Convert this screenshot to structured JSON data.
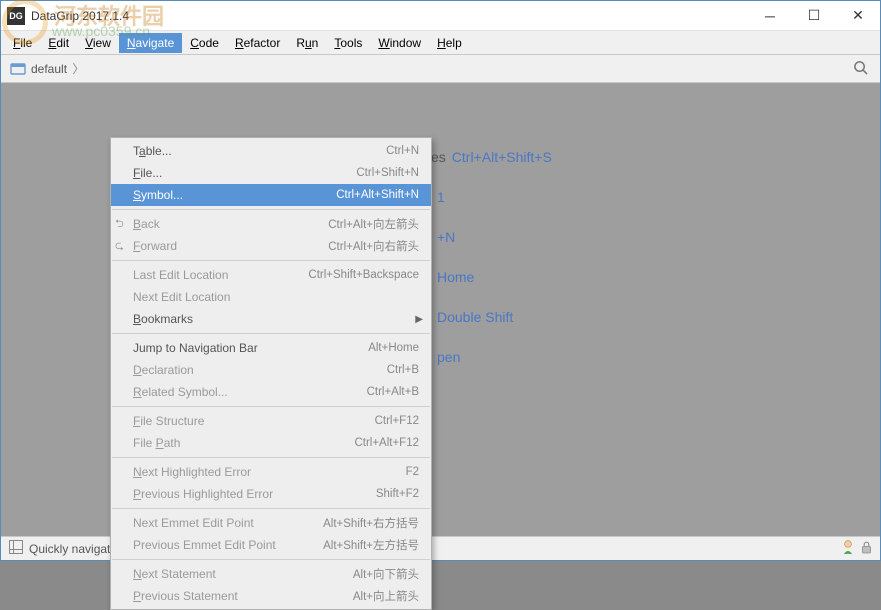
{
  "window": {
    "title": "DataGrip 2017.1.4",
    "icon_label": "DG"
  },
  "watermark": {
    "line1": "河东软件园",
    "line2": "www.pc0359.cn"
  },
  "menubar": {
    "items": [
      {
        "label": "File",
        "mnemonic": "F"
      },
      {
        "label": "Edit",
        "mnemonic": "E"
      },
      {
        "label": "View",
        "mnemonic": "V"
      },
      {
        "label": "Navigate",
        "mnemonic": "N",
        "active": true
      },
      {
        "label": "Code",
        "mnemonic": "C"
      },
      {
        "label": "Refactor",
        "mnemonic": "R"
      },
      {
        "label": "Run",
        "mnemonic": "u"
      },
      {
        "label": "Tools",
        "mnemonic": "T"
      },
      {
        "label": "Window",
        "mnemonic": "W"
      },
      {
        "label": "Help",
        "mnemonic": "H"
      }
    ]
  },
  "breadcrumb": {
    "root": "default"
  },
  "dropdown": {
    "items": [
      {
        "type": "item",
        "label": "Table...",
        "mnemonic": "a",
        "shortcut": "Ctrl+N"
      },
      {
        "type": "item",
        "label": "File...",
        "mnemonic": "F",
        "shortcut": "Ctrl+Shift+N"
      },
      {
        "type": "item",
        "label": "Symbol...",
        "mnemonic": "S",
        "shortcut": "Ctrl+Alt+Shift+N",
        "highlighted": true
      },
      {
        "type": "sep"
      },
      {
        "type": "item",
        "label": "Back",
        "mnemonic": "B",
        "shortcut": "Ctrl+Alt+向左箭头",
        "disabled": true,
        "icon": "back"
      },
      {
        "type": "item",
        "label": "Forward",
        "mnemonic": "F",
        "shortcut": "Ctrl+Alt+向右箭头",
        "disabled": true,
        "icon": "forward"
      },
      {
        "type": "sep"
      },
      {
        "type": "item",
        "label": "Last Edit Location",
        "shortcut": "Ctrl+Shift+Backspace",
        "disabled": true
      },
      {
        "type": "item",
        "label": "Next Edit Location",
        "disabled": true
      },
      {
        "type": "item",
        "label": "Bookmarks",
        "mnemonic": "B",
        "submenu": true
      },
      {
        "type": "sep"
      },
      {
        "type": "item",
        "label": "Jump to Navigation Bar",
        "shortcut": "Alt+Home"
      },
      {
        "type": "item",
        "label": "Declaration",
        "mnemonic": "D",
        "shortcut": "Ctrl+B",
        "disabled": true
      },
      {
        "type": "item",
        "label": "Related Symbol...",
        "mnemonic": "R",
        "shortcut": "Ctrl+Alt+B",
        "disabled": true
      },
      {
        "type": "sep"
      },
      {
        "type": "item",
        "label": "File Structure",
        "mnemonic": "F",
        "shortcut": "Ctrl+F12",
        "disabled": true
      },
      {
        "type": "item",
        "label": "File Path",
        "mnemonic": "P",
        "shortcut": "Ctrl+Alt+F12",
        "disabled": true
      },
      {
        "type": "sep"
      },
      {
        "type": "item",
        "label": "Next Highlighted Error",
        "mnemonic": "N",
        "shortcut": "F2",
        "disabled": true
      },
      {
        "type": "item",
        "label": "Previous Highlighted Error",
        "mnemonic": "P",
        "shortcut": "Shift+F2",
        "disabled": true
      },
      {
        "type": "sep"
      },
      {
        "type": "item",
        "label": "Next Emmet Edit Point",
        "shortcut": "Alt+Shift+右方括号",
        "disabled": true
      },
      {
        "type": "item",
        "label": "Previous Emmet Edit Point",
        "shortcut": "Alt+Shift+左方括号",
        "disabled": true
      },
      {
        "type": "sep"
      },
      {
        "type": "item",
        "label": "Next Statement",
        "mnemonic": "N",
        "shortcut": "Alt+向下箭头",
        "disabled": true
      },
      {
        "type": "item",
        "label": "Previous Statement",
        "mnemonic": "P",
        "shortcut": "Alt+向上箭头",
        "disabled": true
      }
    ]
  },
  "hints": [
    {
      "label": "es",
      "shortcut": "Ctrl+Alt+Shift+S"
    },
    {
      "label": "",
      "shortcut": "1"
    },
    {
      "label": "",
      "shortcut": ""
    },
    {
      "label": "",
      "shortcut": "+N"
    },
    {
      "label": "",
      "shortcut": ""
    },
    {
      "label": "",
      "shortcut": "Home"
    },
    {
      "label": "",
      "shortcut": ""
    },
    {
      "label": "",
      "shortcut": "Double Shift"
    },
    {
      "label": "",
      "shortcut": "pen"
    }
  ],
  "statusbar": {
    "text": "Quickly navigate to any symbol by name"
  }
}
